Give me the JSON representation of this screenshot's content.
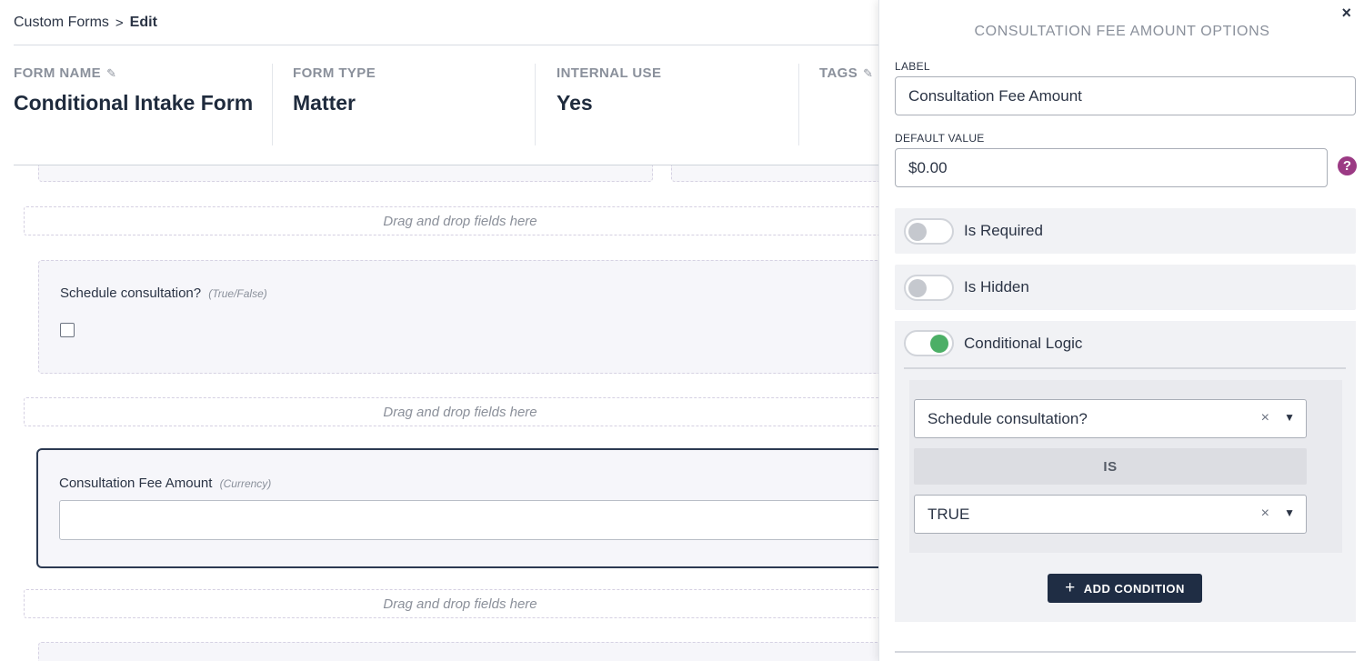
{
  "breadcrumb": {
    "parent": "Custom Forms",
    "separator": ">",
    "current": "Edit"
  },
  "form_meta": {
    "form_name": {
      "label": "FORM NAME",
      "value": "Conditional Intake Form"
    },
    "form_type": {
      "label": "FORM TYPE",
      "value": "Matter"
    },
    "internal_use": {
      "label": "INTERNAL USE",
      "value": "Yes"
    },
    "tags": {
      "label": "TAGS",
      "value": ""
    }
  },
  "canvas": {
    "drop_zone_text": "Drag and drop fields here",
    "fields": [
      {
        "label": "Schedule consultation?",
        "type": "(True/False)"
      },
      {
        "label": "Consultation Fee Amount",
        "type": "(Currency)"
      }
    ]
  },
  "panel": {
    "title": "CONSULTATION FEE AMOUNT OPTIONS",
    "close": "×",
    "label_field": {
      "label": "LABEL",
      "value": "Consultation Fee Amount"
    },
    "default_value": {
      "label": "DEFAULT VALUE",
      "value": "$0.00",
      "help": "?"
    },
    "toggles": {
      "required": {
        "label": "Is Required",
        "on": false
      },
      "hidden": {
        "label": "Is Hidden",
        "on": false
      },
      "conditional": {
        "label": "Conditional Logic",
        "on": true
      }
    },
    "condition": {
      "field": "Schedule consultation?",
      "operator": "IS",
      "value": "TRUE",
      "clear": "×",
      "caret": "▼"
    },
    "add_condition": {
      "icon": "+",
      "label": "ADD CONDITION"
    }
  },
  "colors": {
    "accent_dark": "#1f2d44",
    "toggle_on": "#4caf66",
    "help": "#9b3a84"
  }
}
